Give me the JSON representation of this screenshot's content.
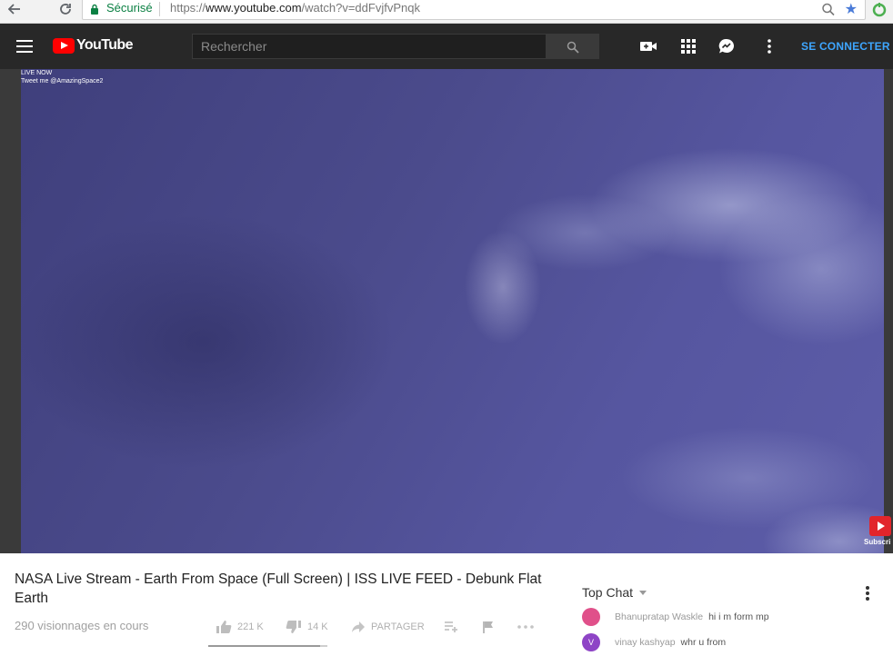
{
  "browser": {
    "secure_label": "Sécurisé",
    "url_scheme": "https://",
    "url_host": "www.youtube.com",
    "url_path": "/watch?v=ddFvjfvPnqk",
    "back_icon": "back-arrow-icon",
    "reload_icon": "reload-icon"
  },
  "header": {
    "logo_text": "YouTube",
    "search_placeholder": "Rechercher",
    "signin_label": "SE CONNECTER"
  },
  "video": {
    "live_label": "LIVE NOW",
    "tweet_label": "Tweet me @AmazingSpace2",
    "subscribe_label": "Subscri"
  },
  "info": {
    "title": "NASA Live Stream - Earth From Space (Full Screen) | ISS LIVE FEED - Debunk Flat Earth",
    "views": "290 visionnages en cours",
    "likes": "221 K",
    "dislikes": "14 K",
    "share_label": "PARTAGER",
    "like_ratio": 0.94
  },
  "chat": {
    "header": "Top Chat",
    "messages": [
      {
        "author": "Bhanupratap Waskle",
        "text": "hi i m form mp",
        "avatar_color": "#e0508a",
        "avatar_letter": ""
      },
      {
        "author": "vinay kashyap",
        "text": "whr u from",
        "avatar_color": "#8e44c6",
        "avatar_letter": "V"
      }
    ]
  },
  "colors": {
    "header_bg": "#282828",
    "accent": "#3ea6ff",
    "brand_red": "#ff0000",
    "secure_green": "#0b8043"
  }
}
